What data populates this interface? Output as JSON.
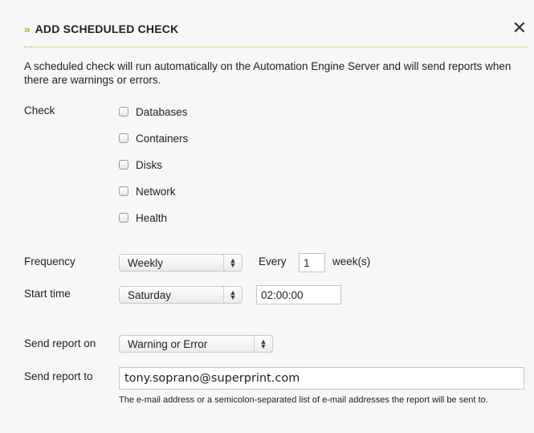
{
  "dialog": {
    "title": "ADD SCHEDULED CHECK",
    "title_prefix": "»",
    "close_glyph": "✕",
    "intro": "A scheduled check will run automatically on the Automation Engine Server and will send reports when there are warnings or errors."
  },
  "check": {
    "label": "Check",
    "options": [
      {
        "label": "Databases",
        "checked": false
      },
      {
        "label": "Containers",
        "checked": false
      },
      {
        "label": "Disks",
        "checked": false
      },
      {
        "label": "Network",
        "checked": false
      },
      {
        "label": "Health",
        "checked": false
      }
    ]
  },
  "frequency": {
    "label": "Frequency",
    "selected": "Weekly",
    "every_label": "Every",
    "every_value": "1",
    "unit_label": "week(s)"
  },
  "start_time": {
    "label": "Start time",
    "day_selected": "Saturday",
    "time_value": "02:00:00"
  },
  "send_report_on": {
    "label": "Send report on",
    "selected": "Warning or Error"
  },
  "send_report_to": {
    "label": "Send report to",
    "value": "tony.soprano@superprint.com",
    "hint": "The e-mail address or a semicolon-separated list of e-mail addresses the report will be sent to."
  },
  "colors": {
    "accent": "#8fc31f",
    "background": "#f7f7f7"
  },
  "icons": {
    "close": "close-icon",
    "select_arrows": "up-down-arrows-icon",
    "checkbox": "checkbox-icon"
  }
}
